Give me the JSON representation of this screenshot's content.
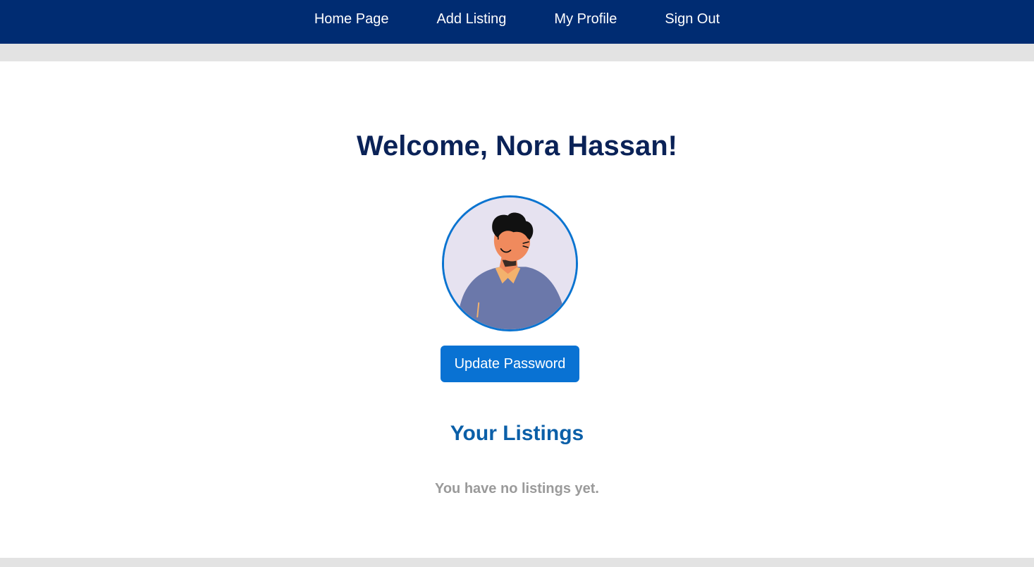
{
  "nav": {
    "items": [
      {
        "label": "Home Page"
      },
      {
        "label": "Add Listing"
      },
      {
        "label": "My Profile"
      },
      {
        "label": "Sign Out"
      }
    ]
  },
  "profile": {
    "welcome": "Welcome, Nora Hassan!",
    "avatar_icon": "user-avatar-illustration",
    "update_password_label": "Update Password"
  },
  "listings": {
    "title": "Your Listings",
    "empty_message": "You have no listings yet."
  },
  "colors": {
    "navbar_bg": "#002c72",
    "primary_button": "#0972d3",
    "welcome_text": "#0a2257",
    "listings_title": "#0b5fa8",
    "muted_text": "#9a9a9a",
    "avatar_border": "#0b74d0"
  }
}
